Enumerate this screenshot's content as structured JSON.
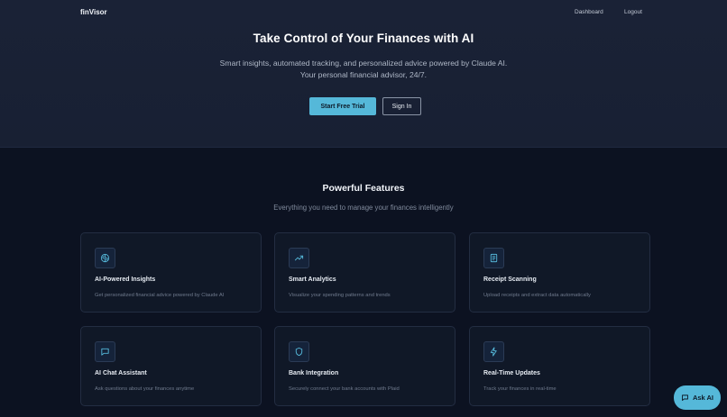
{
  "nav": {
    "logo": "finVisor",
    "links": [
      "Dashboard",
      "Logout"
    ]
  },
  "hero": {
    "title": "Take Control of Your Finances with AI",
    "subtitle_line1": "Smart insights, automated tracking, and personalized advice powered by Claude AI.",
    "subtitle_line2": "Your personal financial advisor, 24/7.",
    "primary_button": "Start Free Trial",
    "secondary_button": "Sign In"
  },
  "features": {
    "title": "Powerful Features",
    "subtitle": "Everything you need to manage your finances intelligently",
    "cards": [
      {
        "title": "AI-Powered Insights",
        "desc": "Get personalized financial advice powered by Claude AI",
        "icon": "brain-icon"
      },
      {
        "title": "Smart Analytics",
        "desc": "Visualize your spending patterns and trends",
        "icon": "trending-up-icon"
      },
      {
        "title": "Receipt Scanning",
        "desc": "Upload receipts and extract data automatically",
        "icon": "receipt-icon"
      },
      {
        "title": "AI Chat Assistant",
        "desc": "Ask questions about your finances anytime",
        "icon": "chat-bubble-icon"
      },
      {
        "title": "Bank Integration",
        "desc": "Securely connect your bank accounts with Plaid",
        "icon": "shield-icon"
      },
      {
        "title": "Real-Time Updates",
        "desc": "Track your finances in real-time",
        "icon": "lightning-icon"
      }
    ]
  },
  "ask_ai": {
    "label": "Ask AI",
    "icon": "chat-bubble-icon"
  },
  "colors": {
    "accent": "#55b8d9",
    "background": "#0c1221",
    "hero_background": "#1a2236",
    "card_background": "#101827"
  }
}
